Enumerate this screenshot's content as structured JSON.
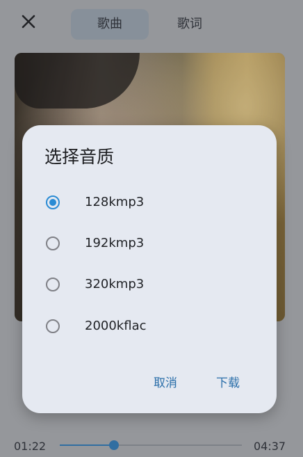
{
  "header": {
    "close_icon": "close-icon",
    "tabs": [
      {
        "label": "歌曲",
        "active": true
      },
      {
        "label": "歌词",
        "active": false
      }
    ]
  },
  "player": {
    "current_time": "01:22",
    "total_time": "04:37",
    "progress_fraction": 0.296
  },
  "dialog": {
    "title": "选择音质",
    "options": [
      {
        "label": "128kmp3",
        "selected": true
      },
      {
        "label": "192kmp3",
        "selected": false
      },
      {
        "label": "320kmp3",
        "selected": false
      },
      {
        "label": "2000kflac",
        "selected": false
      }
    ],
    "cancel_label": "取消",
    "confirm_label": "下载"
  },
  "colors": {
    "accent": "#2a8bd4",
    "dialog_bg": "#e5e9f1",
    "button_text": "#2a6ea9"
  }
}
